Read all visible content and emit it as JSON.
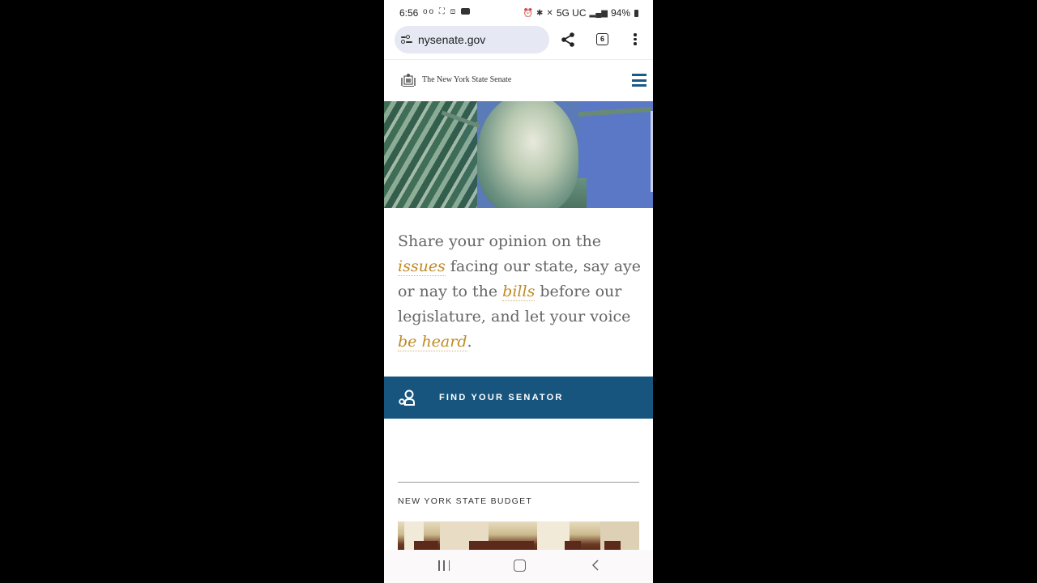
{
  "status_bar": {
    "time": "6:56",
    "left_icons": [
      "voicemail-icon",
      "screenshot-icon",
      "screen-record-icon",
      "youtube-icon"
    ],
    "right_icons": [
      "alarm-icon",
      "bluetooth-icon",
      "mute-icon"
    ],
    "network": "5G UC",
    "battery": "94%"
  },
  "browser": {
    "url": "nysenate.gov",
    "tab_count": "6"
  },
  "site": {
    "name": "The New York State Senate",
    "accent": "#17557f",
    "link_color": "#c08a24"
  },
  "intro": {
    "part1": "Share your opinion on the ",
    "link1": "issues",
    "part2": " facing our state, say aye or nay to the ",
    "link2": "bills",
    "part3": " before our legislature, and let your voice ",
    "link3": "be heard",
    "part4": "."
  },
  "find_senator": {
    "label": "FIND YOUR SENATOR"
  },
  "sections": [
    {
      "title": "NEW YORK STATE BUDGET"
    }
  ]
}
